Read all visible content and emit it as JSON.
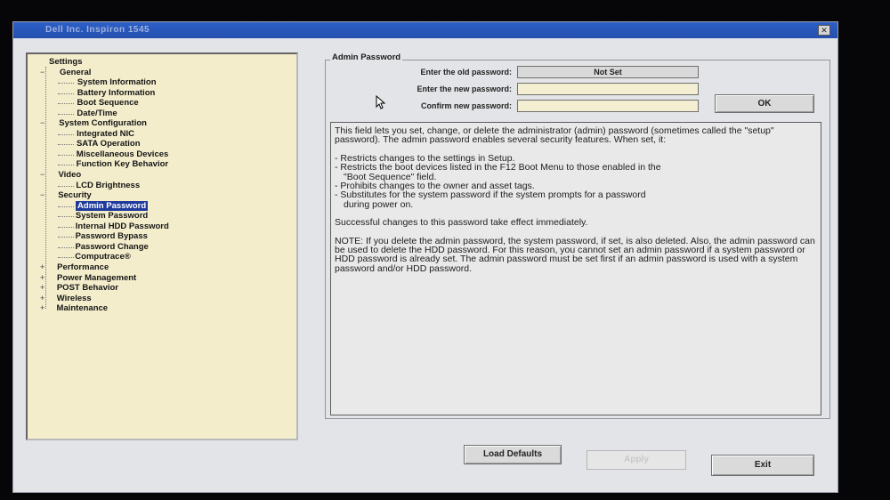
{
  "window": {
    "title": "Dell Inc. Inspiron 1545",
    "close_glyph": "✕"
  },
  "tree": {
    "root": "Settings",
    "nodes": [
      {
        "label": "General",
        "depth": 1,
        "expander": "−"
      },
      {
        "label": "System Information",
        "depth": 2
      },
      {
        "label": "Battery Information",
        "depth": 2
      },
      {
        "label": "Boot Sequence",
        "depth": 2
      },
      {
        "label": "Date/Time",
        "depth": 2
      },
      {
        "label": "System Configuration",
        "depth": 1,
        "expander": "−"
      },
      {
        "label": "Integrated NIC",
        "depth": 2
      },
      {
        "label": "SATA Operation",
        "depth": 2
      },
      {
        "label": "Miscellaneous Devices",
        "depth": 2
      },
      {
        "label": "Function Key Behavior",
        "depth": 2
      },
      {
        "label": "Video",
        "depth": 1,
        "expander": "−"
      },
      {
        "label": "LCD Brightness",
        "depth": 2
      },
      {
        "label": "Security",
        "depth": 1,
        "expander": "−"
      },
      {
        "label": "Admin Password",
        "depth": 2,
        "selected": true
      },
      {
        "label": "System Password",
        "depth": 2
      },
      {
        "label": "Internal HDD Password",
        "depth": 2
      },
      {
        "label": "Password Bypass",
        "depth": 2
      },
      {
        "label": "Password Change",
        "depth": 2
      },
      {
        "label": "Computrace®",
        "depth": 2
      },
      {
        "label": "Performance",
        "depth": 1,
        "expander": "+"
      },
      {
        "label": "Power Management",
        "depth": 1,
        "expander": "+"
      },
      {
        "label": "POST Behavior",
        "depth": 1,
        "expander": "+"
      },
      {
        "label": "Wireless",
        "depth": 1,
        "expander": "+"
      },
      {
        "label": "Maintenance",
        "depth": 1,
        "expander": "+"
      }
    ]
  },
  "admin": {
    "group_title": "Admin Password",
    "old_label": "Enter the old password:",
    "old_value": "Not Set",
    "new_label": "Enter the new password:",
    "new_value": "",
    "confirm_label": "Confirm new password:",
    "confirm_value": "",
    "ok_label": "OK"
  },
  "help": {
    "intro": "This field lets you set, change, or delete the administrator (admin) password (sometimes called the \"setup\" password). The admin password enables several security features. When set, it:",
    "b1": "- Restricts changes to the settings in Setup.",
    "b2": "- Restricts the boot devices listed in the F12 Boot Menu to those enabled in the",
    "b2b": "\"Boot Sequence\" field.",
    "b3": "- Prohibits changes to the owner and asset tags.",
    "b4": "- Substitutes for the system password if the system prompts for a password",
    "b4b": "during power on.",
    "success": "Successful changes to this password take effect immediately.",
    "note": "NOTE: If you delete the admin password, the system password, if set, is also deleted. Also, the admin password can be used to delete the HDD password.  For this reason, you cannot set an admin password if a system password or HDD password is already set. The admin password must be set first if an admin password is used with a system password and/or HDD password."
  },
  "buttons": {
    "load_defaults": "Load Defaults",
    "apply": "Apply",
    "exit": "Exit"
  },
  "colors": {
    "titlebar": "#2d5fc7",
    "tree_bg": "#f3edcc",
    "selection": "#1f3a9c"
  }
}
